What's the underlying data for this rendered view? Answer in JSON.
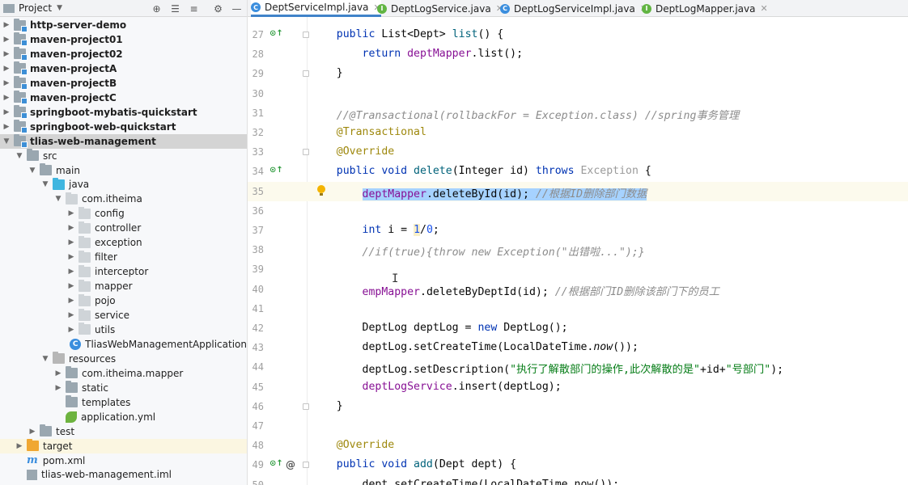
{
  "project_panel": {
    "title": "Project",
    "tree": [
      {
        "label": "http-server-demo",
        "bold": true,
        "indent": 0,
        "chevron": "right",
        "icon": "module-folder"
      },
      {
        "label": "maven-project01",
        "bold": true,
        "indent": 0,
        "chevron": "right",
        "icon": "module-folder"
      },
      {
        "label": "maven-project02",
        "bold": true,
        "indent": 0,
        "chevron": "right",
        "icon": "module-folder"
      },
      {
        "label": "maven-projectA",
        "bold": true,
        "indent": 0,
        "chevron": "right",
        "icon": "module-folder"
      },
      {
        "label": "maven-projectB",
        "bold": true,
        "indent": 0,
        "chevron": "right",
        "icon": "module-folder"
      },
      {
        "label": "maven-projectC",
        "bold": true,
        "indent": 0,
        "chevron": "right",
        "icon": "module-folder"
      },
      {
        "label": "springboot-mybatis-quickstart",
        "bold": true,
        "indent": 0,
        "chevron": "right",
        "icon": "module-folder"
      },
      {
        "label": "springboot-web-quickstart",
        "bold": true,
        "indent": 0,
        "chevron": "right",
        "icon": "module-folder"
      },
      {
        "label": "tlias-web-management",
        "bold": true,
        "indent": 0,
        "chevron": "down",
        "icon": "module-folder",
        "selected": true
      },
      {
        "label": "src",
        "indent": 1,
        "chevron": "down",
        "icon": "folder"
      },
      {
        "label": "main",
        "indent": 2,
        "chevron": "down",
        "icon": "folder"
      },
      {
        "label": "java",
        "indent": 3,
        "chevron": "down",
        "icon": "source-folder"
      },
      {
        "label": "com.itheima",
        "indent": 4,
        "chevron": "down",
        "icon": "package"
      },
      {
        "label": "config",
        "indent": 5,
        "chevron": "right",
        "icon": "package"
      },
      {
        "label": "controller",
        "indent": 5,
        "chevron": "right",
        "icon": "package"
      },
      {
        "label": "exception",
        "indent": 5,
        "chevron": "right",
        "icon": "package"
      },
      {
        "label": "filter",
        "indent": 5,
        "chevron": "right",
        "icon": "package"
      },
      {
        "label": "interceptor",
        "indent": 5,
        "chevron": "right",
        "icon": "package"
      },
      {
        "label": "mapper",
        "indent": 5,
        "chevron": "right",
        "icon": "package"
      },
      {
        "label": "pojo",
        "indent": 5,
        "chevron": "right",
        "icon": "package"
      },
      {
        "label": "service",
        "indent": 5,
        "chevron": "right",
        "icon": "package"
      },
      {
        "label": "utils",
        "indent": 5,
        "chevron": "right",
        "icon": "package"
      },
      {
        "label": "TliasWebManagementApplication",
        "indent": 5,
        "chevron": "none",
        "icon": "spring-class"
      },
      {
        "label": "resources",
        "indent": 3,
        "chevron": "down",
        "icon": "resources-folder"
      },
      {
        "label": "com.itheima.mapper",
        "indent": 4,
        "chevron": "right",
        "icon": "folder"
      },
      {
        "label": "static",
        "indent": 4,
        "chevron": "right",
        "icon": "folder"
      },
      {
        "label": "templates",
        "indent": 4,
        "chevron": "none",
        "icon": "folder"
      },
      {
        "label": "application.yml",
        "indent": 4,
        "chevron": "none",
        "icon": "spring-config"
      },
      {
        "label": "test",
        "indent": 2,
        "chevron": "right",
        "icon": "folder"
      },
      {
        "label": "target",
        "indent": 1,
        "chevron": "right",
        "icon": "excluded-folder",
        "excluded": true
      },
      {
        "label": "pom.xml",
        "indent": 1,
        "chevron": "none",
        "icon": "maven-file"
      },
      {
        "label": "tlias-web-management.iml",
        "indent": 1,
        "chevron": "none",
        "icon": "iml-file"
      }
    ]
  },
  "tabs": [
    {
      "label": "DeptServiceImpl.java",
      "icon": "class",
      "active": true
    },
    {
      "label": "DeptLogService.java",
      "icon": "interface"
    },
    {
      "label": "DeptLogServiceImpl.java",
      "icon": "class"
    },
    {
      "label": "DeptLogMapper.java",
      "icon": "interface"
    }
  ],
  "editor": {
    "lines": [
      {
        "n": "27",
        "gutter": "override",
        "fold": true,
        "tokens": [
          [
            "",
            "    "
          ],
          [
            "kw",
            "public "
          ],
          [
            "",
            "List<Dept> "
          ],
          [
            "mfn",
            "list"
          ],
          [
            "",
            "() {"
          ]
        ]
      },
      {
        "n": "28",
        "tokens": [
          [
            "",
            "        "
          ],
          [
            "kw",
            "return "
          ],
          [
            "fld",
            "deptMapper"
          ],
          [
            "",
            ".list();"
          ]
        ]
      },
      {
        "n": "29",
        "fold": true,
        "tokens": [
          [
            "",
            "    }"
          ]
        ]
      },
      {
        "n": "30",
        "tokens": []
      },
      {
        "n": "31",
        "tokens": [
          [
            "",
            "    "
          ],
          [
            "cmt",
            "//@Transactional(rollbackFor = Exception.class) //spring事务管理"
          ]
        ]
      },
      {
        "n": "32",
        "tokens": [
          [
            "",
            "    "
          ],
          [
            "ann",
            "@Transactional"
          ]
        ]
      },
      {
        "n": "33",
        "fold": true,
        "tokens": [
          [
            "",
            "    "
          ],
          [
            "ann",
            "@Override"
          ]
        ]
      },
      {
        "n": "34",
        "gutter": "override",
        "tokens": [
          [
            "",
            "    "
          ],
          [
            "kw",
            "public void "
          ],
          [
            "mfn",
            "delete"
          ],
          [
            "",
            "(Integer id) "
          ],
          [
            "kw",
            "throws "
          ],
          [
            "grey",
            "Exception"
          ],
          [
            "",
            " {"
          ]
        ]
      },
      {
        "n": "35",
        "current": true,
        "bulb": true,
        "tokens": [
          [
            "",
            "        "
          ],
          [
            "sel fld",
            "deptMapper"
          ],
          [
            "sel",
            ".deleteById(id); "
          ],
          [
            "sel cmt",
            "//根据ID删除部门数据"
          ]
        ]
      },
      {
        "n": "36",
        "tokens": []
      },
      {
        "n": "37",
        "tokens": [
          [
            "",
            "        "
          ],
          [
            "kw",
            "int "
          ],
          [
            "",
            "i = "
          ],
          [
            "num hl-num",
            "1"
          ],
          [
            "",
            "/"
          ],
          [
            "num",
            "0"
          ],
          [
            "",
            ";"
          ]
        ]
      },
      {
        "n": "38",
        "tokens": [
          [
            "",
            "        "
          ],
          [
            "cmt",
            "//if(true){throw new Exception(\"出错啦...\");}"
          ]
        ]
      },
      {
        "n": "39",
        "tokens": []
      },
      {
        "n": "40",
        "tokens": [
          [
            "",
            "        "
          ],
          [
            "fld",
            "empMapper"
          ],
          [
            "",
            ".deleteByDeptId(id); "
          ],
          [
            "cmt",
            "//根据部门ID删除该部门下的员工"
          ]
        ]
      },
      {
        "n": "41",
        "tokens": []
      },
      {
        "n": "42",
        "tokens": [
          [
            "",
            "        DeptLog deptLog = "
          ],
          [
            "kw",
            "new "
          ],
          [
            "",
            "DeptLog();"
          ]
        ]
      },
      {
        "n": "43",
        "tokens": [
          [
            "",
            "        deptLog.setCreateTime(LocalDateTime."
          ],
          [
            "static",
            "now"
          ],
          [
            "",
            "());"
          ]
        ]
      },
      {
        "n": "44",
        "tokens": [
          [
            "",
            "        deptLog.setDescription("
          ],
          [
            "str",
            "\"执行了解散部门的操作,此次解散的是\""
          ],
          [
            "",
            "+id+"
          ],
          [
            "str",
            "\"号部门\""
          ],
          [
            "",
            ");"
          ]
        ]
      },
      {
        "n": "45",
        "tokens": [
          [
            "",
            "        "
          ],
          [
            "fld",
            "deptLogService"
          ],
          [
            "",
            ".insert(deptLog);"
          ]
        ]
      },
      {
        "n": "46",
        "fold": true,
        "tokens": [
          [
            "",
            "    }"
          ]
        ]
      },
      {
        "n": "47",
        "tokens": []
      },
      {
        "n": "48",
        "tokens": [
          [
            "",
            "    "
          ],
          [
            "ann",
            "@Override"
          ]
        ]
      },
      {
        "n": "49",
        "gutter": "override-at",
        "fold": true,
        "tokens": [
          [
            "",
            "    "
          ],
          [
            "kw",
            "public void "
          ],
          [
            "mfn",
            "add"
          ],
          [
            "",
            "(Dept dept) {"
          ]
        ]
      },
      {
        "n": "50",
        "tokens": [
          [
            "",
            "        dept.setCreateTime(LocalDateTime.now());"
          ]
        ]
      }
    ]
  },
  "colors": {
    "keyword": "#0033b3",
    "field": "#871094",
    "annotation": "#9e880d",
    "comment": "#8c8c8c",
    "string": "#067d17",
    "selection": "#a6d2ff",
    "current_line": "#fcfaed",
    "active_tab_underline": "#4083c9"
  }
}
